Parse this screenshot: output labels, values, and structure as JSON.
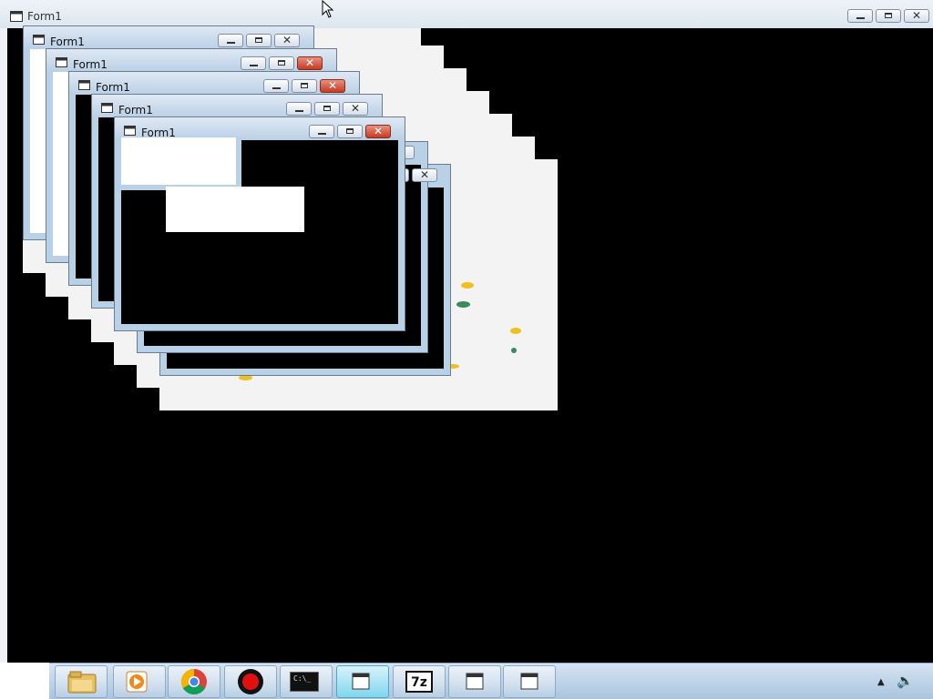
{
  "outer_window": {
    "title": "Form1",
    "controls": [
      "minimize",
      "maximize",
      "close"
    ]
  },
  "forms": [
    {
      "title": "Form1",
      "close_style": "normal"
    },
    {
      "title": "Form1",
      "close_style": "red"
    },
    {
      "title": "Form1",
      "close_style": "red"
    },
    {
      "title": "Form1",
      "close_style": "normal"
    },
    {
      "title": "Form1",
      "close_style": "red"
    }
  ],
  "taskbar": {
    "apps": [
      {
        "name": "file-explorer",
        "icon": "folder-icon"
      },
      {
        "name": "media-player",
        "icon": "play-icon"
      },
      {
        "name": "chrome",
        "icon": "chrome-icon"
      },
      {
        "name": "recorder",
        "icon": "record-icon"
      },
      {
        "name": "command-prompt",
        "icon": "cmd-icon",
        "text": "C:\\_"
      },
      {
        "name": "form-window-active",
        "icon": "window-icon"
      },
      {
        "name": "7zip",
        "icon": "7zip-icon",
        "text": "7z"
      },
      {
        "name": "form-window",
        "icon": "window-icon"
      },
      {
        "name": "form-window",
        "icon": "window-icon"
      }
    ],
    "tray": [
      "show-hidden-icons-arrow",
      "volume-icon"
    ]
  },
  "colors": {
    "desktop": "#000000",
    "window_frame": "#b9d1e6",
    "close_red": "#c83a24",
    "taskbar": "#bcd2e8",
    "dot_yellow": "#f0c020",
    "dot_green": "#3a8a5a"
  }
}
